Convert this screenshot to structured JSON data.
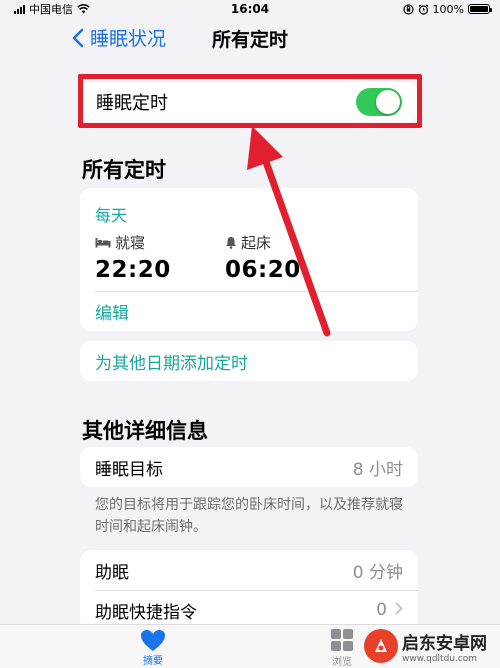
{
  "status_bar": {
    "carrier": "中国电信",
    "time": "16:04",
    "battery": "100%"
  },
  "nav": {
    "back_label": "睡眠状况",
    "title": "所有定时"
  },
  "sleep_schedule_toggle": {
    "label": "睡眠定时",
    "enabled": true
  },
  "all_schedules": {
    "header": "所有定时",
    "frequency": "每天",
    "bedtime_label": "就寝",
    "bedtime": "22:20",
    "wake_label": "起床",
    "wake_time": "06:20",
    "edit_label": "编辑",
    "add_label": "为其他日期添加定时"
  },
  "details": {
    "header": "其他详细信息",
    "sleep_goal_label": "睡眠目标",
    "sleep_goal_value": "8 小时",
    "note": "您的目标将用于跟踪您的卧床时间，以及推荐就寝时间和起床闹钟。",
    "wind_down_label": "助眠",
    "wind_down_value": "0 分钟",
    "shortcuts_label": "助眠快捷指令",
    "shortcuts_value": "0"
  },
  "tab_bar": {
    "summary_label": "摘要",
    "browse_label": "浏览"
  },
  "watermark": {
    "name": "启东安卓网",
    "url": "www.qdltdu.com"
  },
  "colors": {
    "accent_blue": "#1a73e8",
    "accent_teal": "#1aa89c",
    "toggle_green": "#34c759",
    "annotation_red": "#e0202e"
  },
  "annotation": {
    "type": "red-arrow-and-box",
    "target": "sleep_schedule_toggle"
  }
}
